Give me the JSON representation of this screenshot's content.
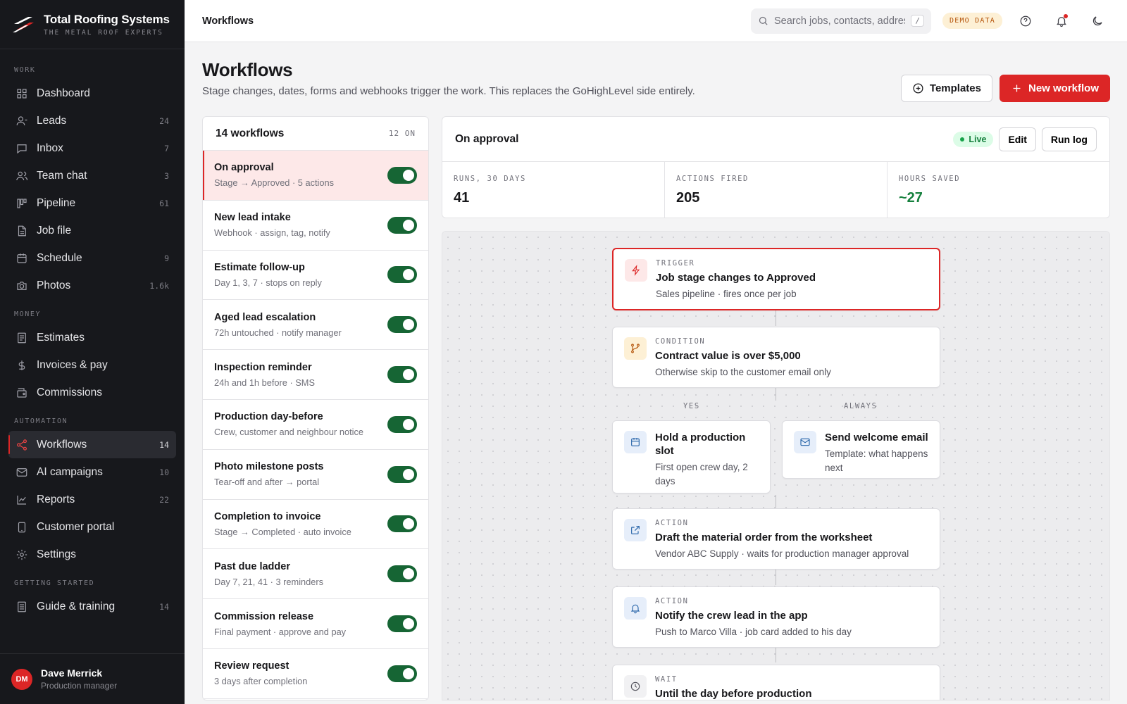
{
  "brand": {
    "name": "Total Roofing Systems",
    "tagline": "THE METAL ROOF EXPERTS"
  },
  "sidebar": {
    "sections": [
      {
        "label": "WORK",
        "items": [
          {
            "label": "Dashboard",
            "count": "",
            "icon": "dashboard-icon"
          },
          {
            "label": "Leads",
            "count": "24",
            "icon": "user-icon"
          },
          {
            "label": "Inbox",
            "count": "7",
            "icon": "chat-bubble-icon"
          },
          {
            "label": "Team chat",
            "count": "3",
            "icon": "team-icon"
          },
          {
            "label": "Pipeline",
            "count": "61",
            "icon": "kanban-icon"
          },
          {
            "label": "Job file",
            "count": "",
            "icon": "file-icon"
          },
          {
            "label": "Schedule",
            "count": "9",
            "icon": "calendar-icon"
          },
          {
            "label": "Photos",
            "count": "1.6k",
            "icon": "camera-icon"
          }
        ]
      },
      {
        "label": "MONEY",
        "items": [
          {
            "label": "Estimates",
            "count": "",
            "icon": "document-icon"
          },
          {
            "label": "Invoices & pay",
            "count": "",
            "icon": "dollar-icon"
          },
          {
            "label": "Commissions",
            "count": "",
            "icon": "wallet-icon"
          }
        ]
      },
      {
        "label": "AUTOMATION",
        "items": [
          {
            "label": "Workflows",
            "count": "14",
            "icon": "share-icon",
            "active": true
          },
          {
            "label": "AI campaigns",
            "count": "10",
            "icon": "mail-icon"
          },
          {
            "label": "Reports",
            "count": "22",
            "icon": "chart-icon"
          },
          {
            "label": "Customer portal",
            "count": "",
            "icon": "phone-icon"
          },
          {
            "label": "Settings",
            "count": "",
            "icon": "gear-icon"
          }
        ]
      },
      {
        "label": "GETTING STARTED",
        "items": [
          {
            "label": "Guide & training",
            "count": "14",
            "icon": "book-icon"
          }
        ]
      }
    ]
  },
  "user": {
    "initials": "DM",
    "name": "Dave Merrick",
    "role": "Production manager"
  },
  "topbar": {
    "title": "Workflows",
    "search_placeholder": "Search jobs, contacts, addresses",
    "search_kbd": "/",
    "demo_badge": "DEMO DATA"
  },
  "page": {
    "title": "Workflows",
    "subtitle": "Stage changes, dates, forms and webhooks trigger the work. This replaces the GoHighLevel side entirely.",
    "templates_label": "Templates",
    "new_label": "New workflow"
  },
  "workflows": {
    "header": "14 workflows",
    "on_count": "12 ON",
    "items": [
      {
        "name": "On approval",
        "desc": "Stage → Approved · 5 actions",
        "enabled": true,
        "selected": true
      },
      {
        "name": "New lead intake",
        "desc": "Webhook · assign, tag, notify",
        "enabled": true
      },
      {
        "name": "Estimate follow-up",
        "desc": "Day 1, 3, 7 · stops on reply",
        "enabled": true
      },
      {
        "name": "Aged lead escalation",
        "desc": "72h untouched · notify manager",
        "enabled": true
      },
      {
        "name": "Inspection reminder",
        "desc": "24h and 1h before · SMS",
        "enabled": true
      },
      {
        "name": "Production day-before",
        "desc": "Crew, customer and neighbour notice",
        "enabled": true
      },
      {
        "name": "Photo milestone posts",
        "desc": "Tear-off and after → portal",
        "enabled": true
      },
      {
        "name": "Completion to invoice",
        "desc": "Stage → Completed · auto invoice",
        "enabled": true
      },
      {
        "name": "Past due ladder",
        "desc": "Day 7, 21, 41 · 3 reminders",
        "enabled": true
      },
      {
        "name": "Commission release",
        "desc": "Final payment · approve and pay",
        "enabled": true
      },
      {
        "name": "Review request",
        "desc": "3 days after completion",
        "enabled": true
      }
    ]
  },
  "detail": {
    "title": "On approval",
    "status": "Live",
    "edit_label": "Edit",
    "runlog_label": "Run log",
    "stats": [
      {
        "label": "RUNS, 30 DAYS",
        "value": "41"
      },
      {
        "label": "ACTIONS FIRED",
        "value": "205"
      },
      {
        "label": "HOURS SAVED",
        "value": "~27"
      }
    ]
  },
  "flow": {
    "trigger": {
      "kind": "TRIGGER",
      "title": "Job stage changes to Approved",
      "desc": "Sales pipeline · fires once per job"
    },
    "condition": {
      "kind": "CONDITION",
      "title": "Contract value is over $5,000",
      "desc": "Otherwise skip to the customer email only"
    },
    "branch_yes": "YES",
    "branch_always": "ALWAYS",
    "hold": {
      "title": "Hold a production slot",
      "desc": "First open crew day, 2 days"
    },
    "welcome": {
      "title": "Send welcome email",
      "desc": "Template: what happens next"
    },
    "action1": {
      "kind": "ACTION",
      "title": "Draft the material order from the worksheet",
      "desc": "Vendor ABC Supply · waits for production manager approval"
    },
    "action2": {
      "kind": "ACTION",
      "title": "Notify the crew lead in the app",
      "desc": "Push to Marco Villa · job card added to his day"
    },
    "wait": {
      "kind": "WAIT",
      "title": "Until the day before production"
    }
  }
}
